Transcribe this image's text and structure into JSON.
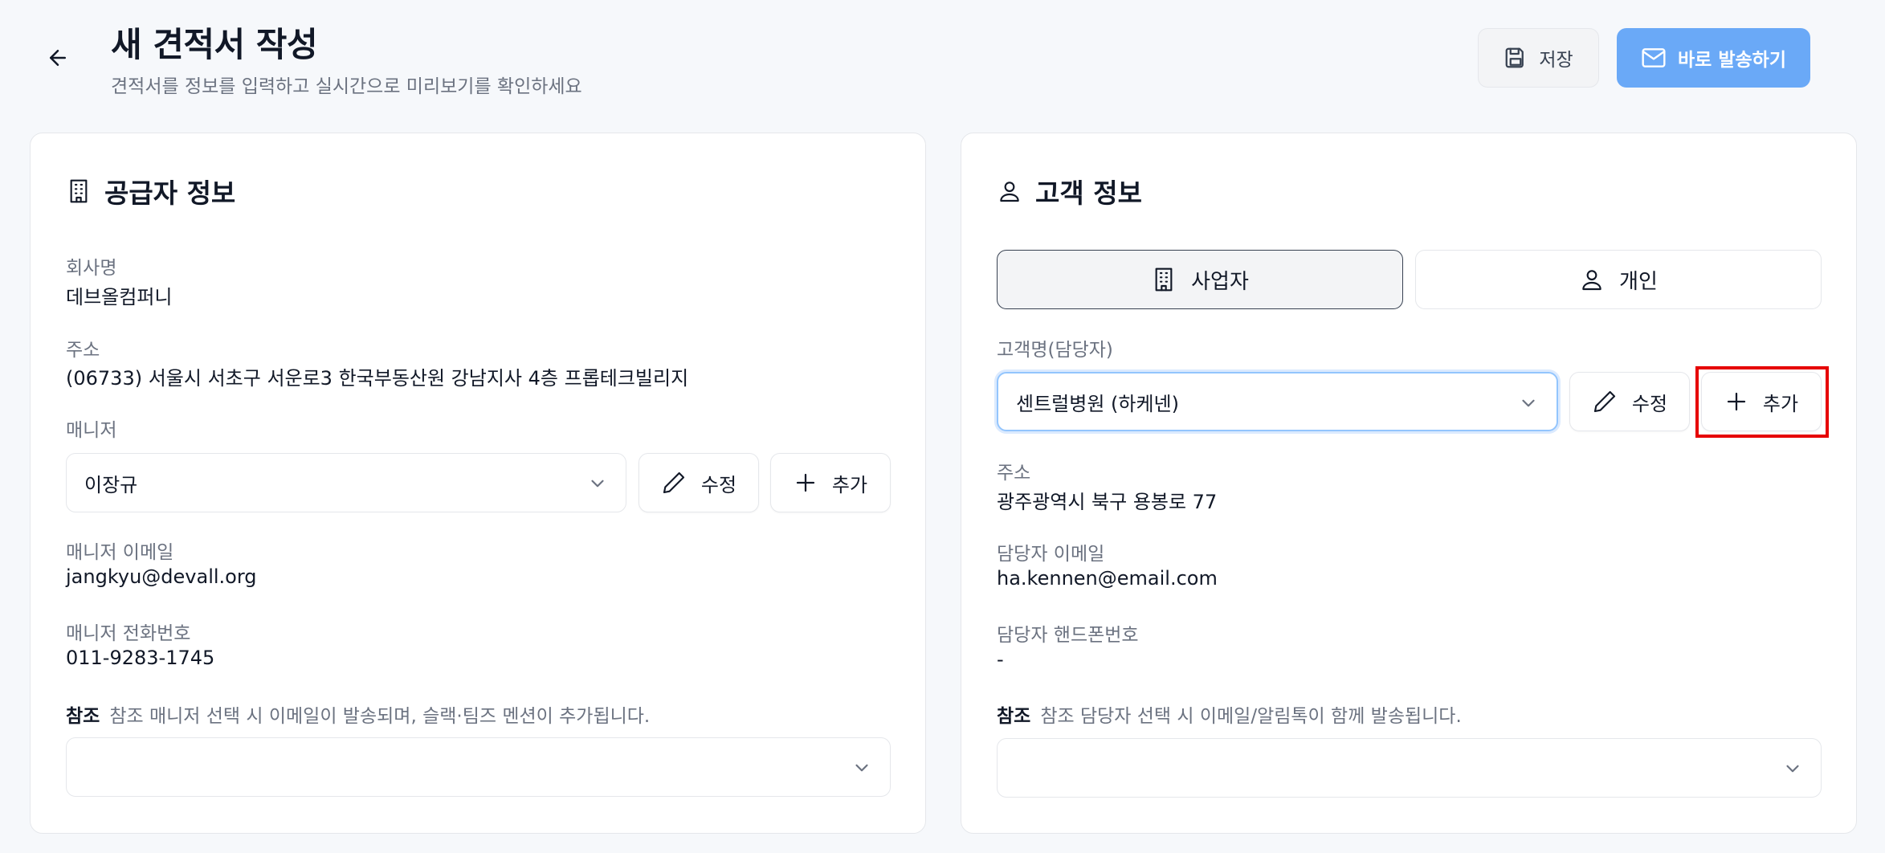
{
  "header": {
    "title": "새 견적서 작성",
    "subtitle": "견적서를 정보를 입력하고 실시간으로 미리보기를 확인하세요",
    "save_label": "저장",
    "send_label": "바로 발송하기"
  },
  "supplier": {
    "title": "공급자 정보",
    "company_label": "회사명",
    "company_value": "데브올컴퍼니",
    "address_label": "주소",
    "address_value": "(06733) 서울시 서초구 서운로3 한국부동산원 강남지사 4층 프롭테크빌리지",
    "manager_label": "매니저",
    "manager_selected": "이장규",
    "edit_label": "수정",
    "add_label": "추가",
    "manager_email_label": "매니저 이메일",
    "manager_email_value": "jangkyu@devall.org",
    "manager_phone_label": "매니저 전화번호",
    "manager_phone_value": "011-9283-1745",
    "ref_label": "참조",
    "ref_note": "참조 매니저 선택 시 이메일이 발송되며, 슬랙·팀즈 멘션이 추가됩니다.",
    "ref_selected": ""
  },
  "customer": {
    "title": "고객 정보",
    "toggle_business": "사업자",
    "toggle_individual": "개인",
    "name_label": "고객명(담당자)",
    "name_selected": "센트럴병원 (하케넨)",
    "edit_label": "수정",
    "add_label": "추가",
    "address_label": "주소",
    "address_value": "광주광역시 북구 용봉로 77",
    "email_label": "담당자 이메일",
    "email_value": "ha.kennen@email.com",
    "phone_label": "담당자 핸드폰번호",
    "phone_value": "-",
    "ref_label": "참조",
    "ref_note": "참조 담당자 선택 시 이메일/알림톡이 함께 발송됩니다.",
    "ref_selected": ""
  },
  "colors": {
    "primary": "#6aa9f7",
    "highlight": "#e60000",
    "focus_border": "#93c5fd"
  },
  "icons": [
    "arrow-left-icon",
    "save-icon",
    "mail-icon",
    "building-icon",
    "user-icon",
    "chevron-down-icon",
    "pencil-icon",
    "plus-icon"
  ]
}
